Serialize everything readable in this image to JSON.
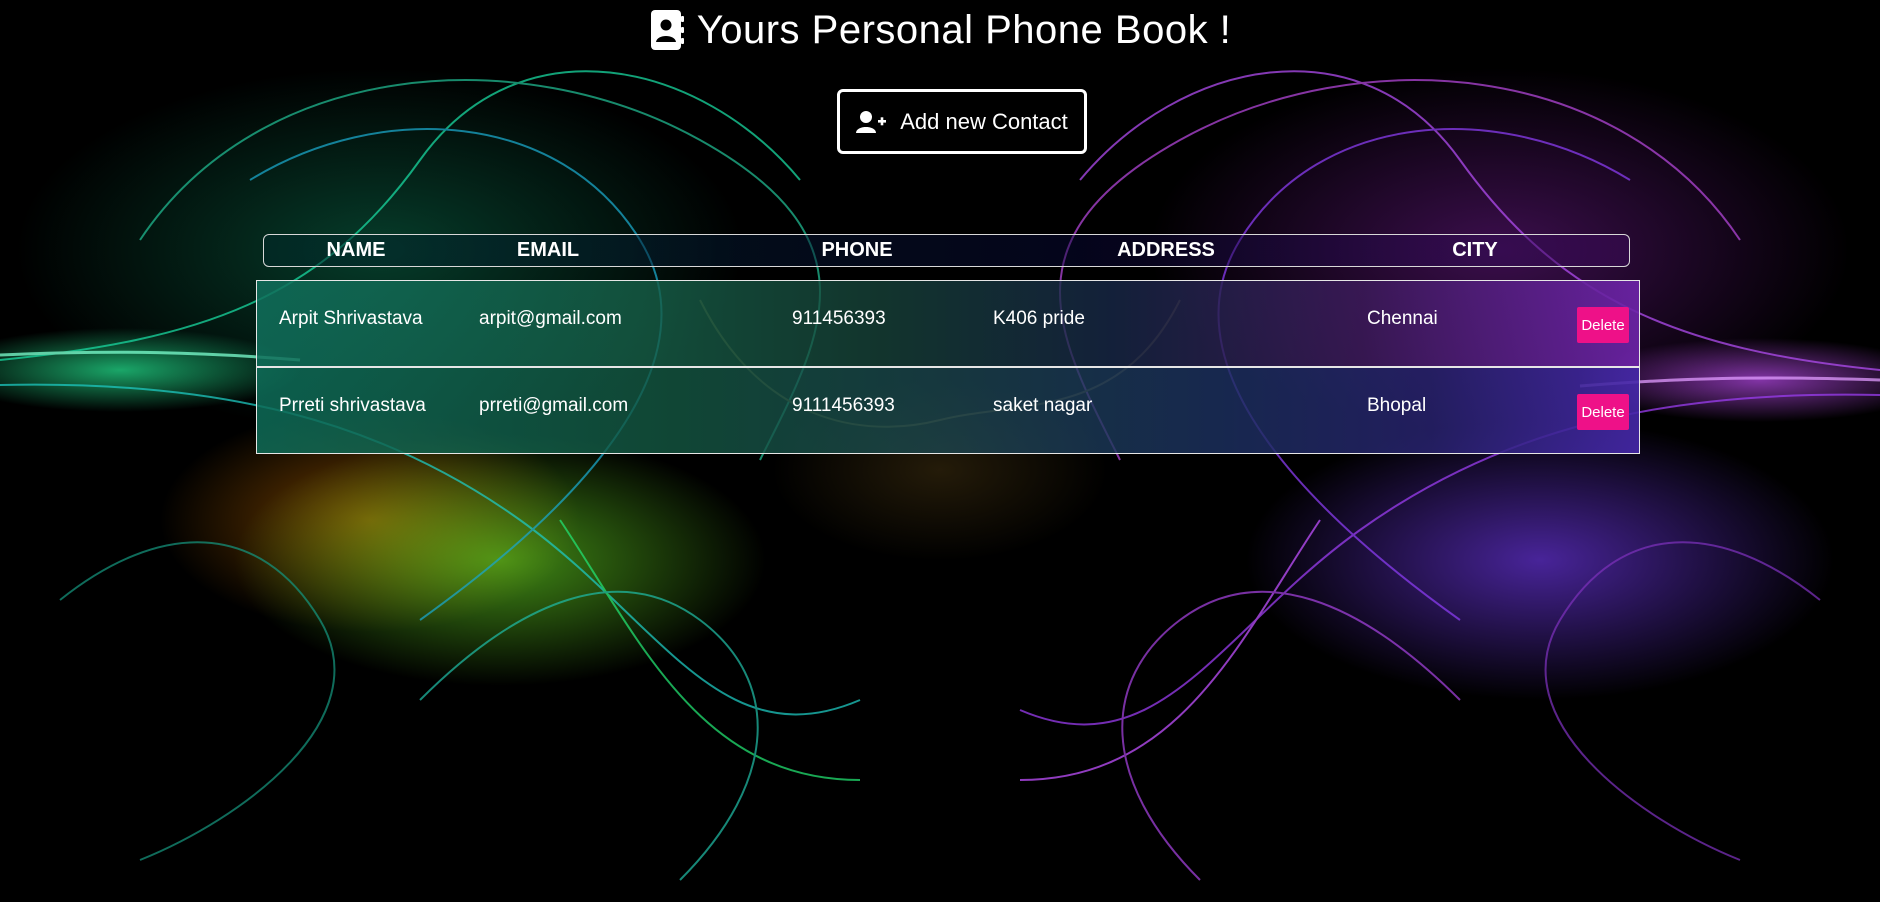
{
  "colors": {
    "background": "#000000",
    "delete_button": "#ee1188",
    "text": "#ffffff"
  },
  "header": {
    "icon": "address-book-icon",
    "title": "Yours Personal Phone Book !"
  },
  "actions": {
    "add_icon": "user-plus-icon",
    "add_label": "Add new Contact"
  },
  "table": {
    "columns": [
      "NAME",
      "EMAIL",
      "PHONE",
      "ADDRESS",
      "CITY"
    ],
    "delete_label": "Delete",
    "rows": [
      {
        "name": "Arpit Shrivastava",
        "email": "arpit@gmail.com",
        "phone": "911456393",
        "address": "K406 pride",
        "city": "Chennai"
      },
      {
        "name": "Prreti shrivastava",
        "email": "prreti@gmail.com",
        "phone": "9111456393",
        "address": "saket nagar",
        "city": "Bhopal"
      }
    ]
  }
}
